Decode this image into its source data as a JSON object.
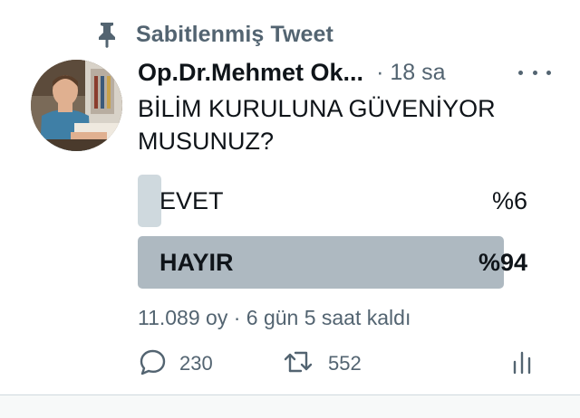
{
  "pinned": {
    "label": "Sabitlenmiş Tweet",
    "icon": "pin-icon"
  },
  "tweet": {
    "author_name": "Op.Dr.Mehmet Ok...",
    "time": "· 18 sa",
    "text": "BİLİM KURULUNA GÜVENİYOR\nMUSUNUZ?"
  },
  "poll": {
    "options": [
      {
        "label": "EVET",
        "percent_label": "%6",
        "percent": 6
      },
      {
        "label": "HAYIR",
        "percent_label": "%94",
        "percent": 94
      }
    ],
    "meta": "11.089 oy · 6 gün 5 saat kaldı"
  },
  "actions": {
    "reply_count": "230",
    "retweet_count": "552"
  },
  "colors": {
    "text_primary": "#0f1419",
    "text_secondary": "#536471",
    "poll_bar": "#cfd9de",
    "poll_bar_leading": "#aeb9c1"
  }
}
